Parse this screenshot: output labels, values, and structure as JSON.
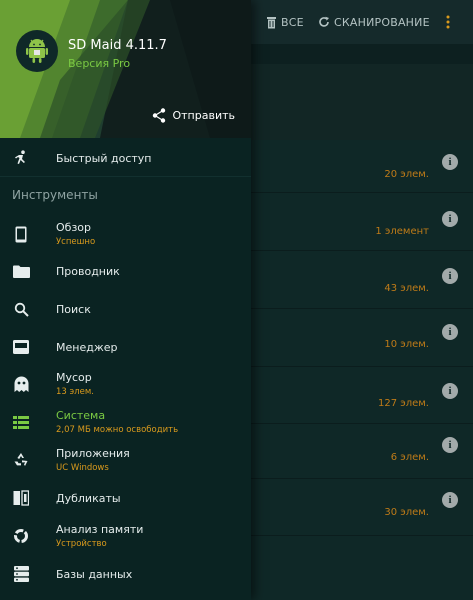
{
  "toolbar": {
    "all_label": "ВСЕ",
    "scan_label": "СКАНИРОВАНИЕ"
  },
  "drawer": {
    "app_name": "SD Maid 4.11.7",
    "version_label": "Версия Pro",
    "share_label": "Отправить",
    "quick_access": "Быстрый доступ",
    "section_title": "Инструменты",
    "items": [
      {
        "label": "Обзор",
        "sub": "Успешно",
        "icon": "phone-icon"
      },
      {
        "label": "Проводник",
        "sub": "",
        "icon": "folder-icon"
      },
      {
        "label": "Поиск",
        "sub": "",
        "icon": "search-icon"
      },
      {
        "label": "Менеджер",
        "sub": "",
        "icon": "app-manager-icon"
      },
      {
        "label": "Мусор",
        "sub": "13 элем.",
        "icon": "ghost-icon"
      },
      {
        "label": "Система",
        "sub": "2,07 МБ можно освободить",
        "icon": "system-list-icon"
      },
      {
        "label": "Приложения",
        "sub": "UC Windows",
        "icon": "recycle-icon"
      },
      {
        "label": "Дубликаты",
        "sub": "",
        "icon": "duplicates-icon"
      },
      {
        "label": "Анализ памяти",
        "sub": "Устройство",
        "icon": "storage-analyzer-icon"
      },
      {
        "label": "Базы данных",
        "sub": "",
        "icon": "database-icon"
      }
    ]
  },
  "background": {
    "counts": [
      "20 элем.",
      "1 элемент",
      "43 элем.",
      "10 элем.",
      "127 элем.",
      "6 элем.",
      "30 элем."
    ]
  },
  "colors": {
    "accent_green": "#7ac943",
    "accent_orange": "#d99a1d",
    "count_orange": "#bf7b18"
  }
}
